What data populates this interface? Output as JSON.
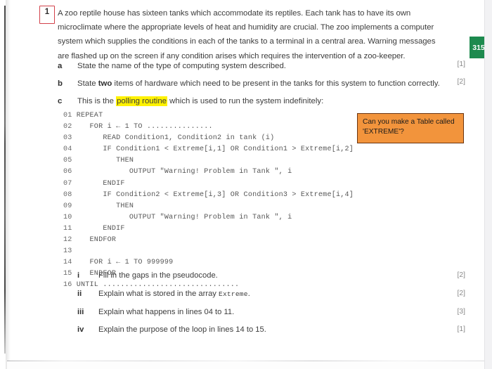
{
  "page": {
    "page_number_badge": "315",
    "badge_color": "#1d8a4e",
    "question_number": "1",
    "annotation_box_color": "#d2414a",
    "highlight_color": "#fff200"
  },
  "question": {
    "stem_parts": [
      "A zoo reptile house has sixteen tanks which accommodate its reptiles. Each tank has to have its own microclimate where the appropriate levels of heat and humidity are crucial. The zoo implements a computer system which supplies the conditions in each of the tanks to a terminal in a central area. Warning messages are flashed up on the screen if any condition arises which requires the intervention of a zoo-keeper."
    ],
    "parts": [
      {
        "letter": "a",
        "text": "State the name of the type of computing system described.",
        "marks": "[1]"
      },
      {
        "letter": "b",
        "text_before": "State ",
        "bold": "two",
        "text_after": " items of hardware which need to be present in the tanks for this system to function correctly.",
        "marks": "[2]"
      },
      {
        "letter": "c",
        "text_before": "This is the ",
        "highlight": "polling routine",
        "text_after": " which is used to run the system indefinitely:",
        "marks": ""
      }
    ]
  },
  "pseudocode": {
    "lines": [
      {
        "num": "01",
        "code": "REPEAT"
      },
      {
        "num": "02",
        "code": "   FOR i ← 1 TO ..............."
      },
      {
        "num": "03",
        "code": "      READ Condition1, Condition2 in tank (i)"
      },
      {
        "num": "04",
        "code": "      IF Condition1 < Extreme[i,1] OR Condition1 > Extreme[i,2]"
      },
      {
        "num": "05",
        "code": "         THEN"
      },
      {
        "num": "06",
        "code": "            OUTPUT \"Warning! Problem in Tank \", i"
      },
      {
        "num": "07",
        "code": "      ENDIF"
      },
      {
        "num": "08",
        "code": "      IF Condition2 < Extreme[i,3] OR Condition3 > Extreme[i,4]"
      },
      {
        "num": "09",
        "code": "         THEN"
      },
      {
        "num": "10",
        "code": "            OUTPUT \"Warning! Problem in Tank \", i"
      },
      {
        "num": "11",
        "code": "      ENDIF"
      },
      {
        "num": "12",
        "code": "   ENDFOR"
      },
      {
        "num": "13",
        "code": ""
      },
      {
        "num": "14",
        "code": "   FOR i ← 1 TO 999999"
      },
      {
        "num": "15",
        "code": "   ENDFOR"
      },
      {
        "num": "16",
        "code": "UNTIL ..............................."
      }
    ]
  },
  "callout": {
    "text": "Can you make a Table called 'EXTREME'?",
    "background": "#f2943c",
    "border": "#6b3410"
  },
  "subparts": [
    {
      "numeral": "i",
      "text": "Fill in the gaps in the pseudocode.",
      "marks": "[2]"
    },
    {
      "numeral": "ii",
      "text_before": "Explain what is stored in the array ",
      "mono": "Extreme",
      "text_after": ".",
      "marks": "[2]"
    },
    {
      "numeral": "iii",
      "text": "Explain what happens in lines 04 to 11.",
      "marks": "[3]"
    },
    {
      "numeral": "iv",
      "text": "Explain the purpose of the loop in lines 14 to 15.",
      "marks": "[1]"
    }
  ]
}
